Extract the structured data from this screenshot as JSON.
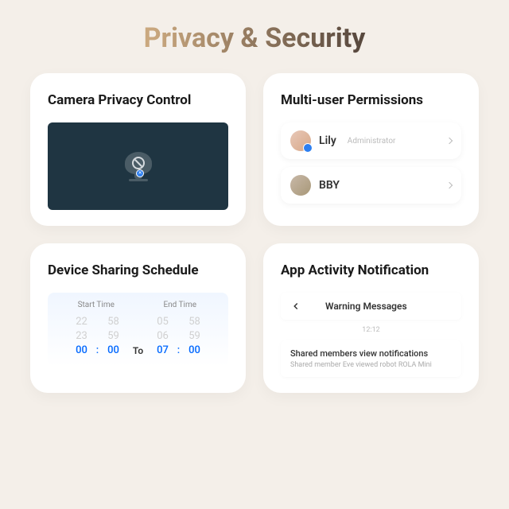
{
  "page_title": "Privacy & Security",
  "cards": {
    "camera": {
      "title": "Camera Privacy Control"
    },
    "permissions": {
      "title": "Multi-user Permissions",
      "users": [
        {
          "name": "Lily",
          "role": "Administrator"
        },
        {
          "name": "BBY",
          "role": ""
        }
      ]
    },
    "schedule": {
      "title": "Device Sharing Schedule",
      "start_label": "Start Time",
      "end_label": "End Time",
      "to_label": "To",
      "rows": [
        {
          "sh": "22",
          "sm": "58",
          "eh": "05",
          "em": "58"
        },
        {
          "sh": "23",
          "sm": "59",
          "eh": "06",
          "em": "59"
        },
        {
          "sh": "00",
          "sm": "00",
          "eh": "07",
          "em": "00"
        }
      ]
    },
    "activity": {
      "title": "App Activity Notification",
      "header": "Warning Messages",
      "time": "12:12",
      "item_title": "Shared members view notifications",
      "item_body": "Shared member Eve viewed robot ROLA Mini"
    }
  }
}
